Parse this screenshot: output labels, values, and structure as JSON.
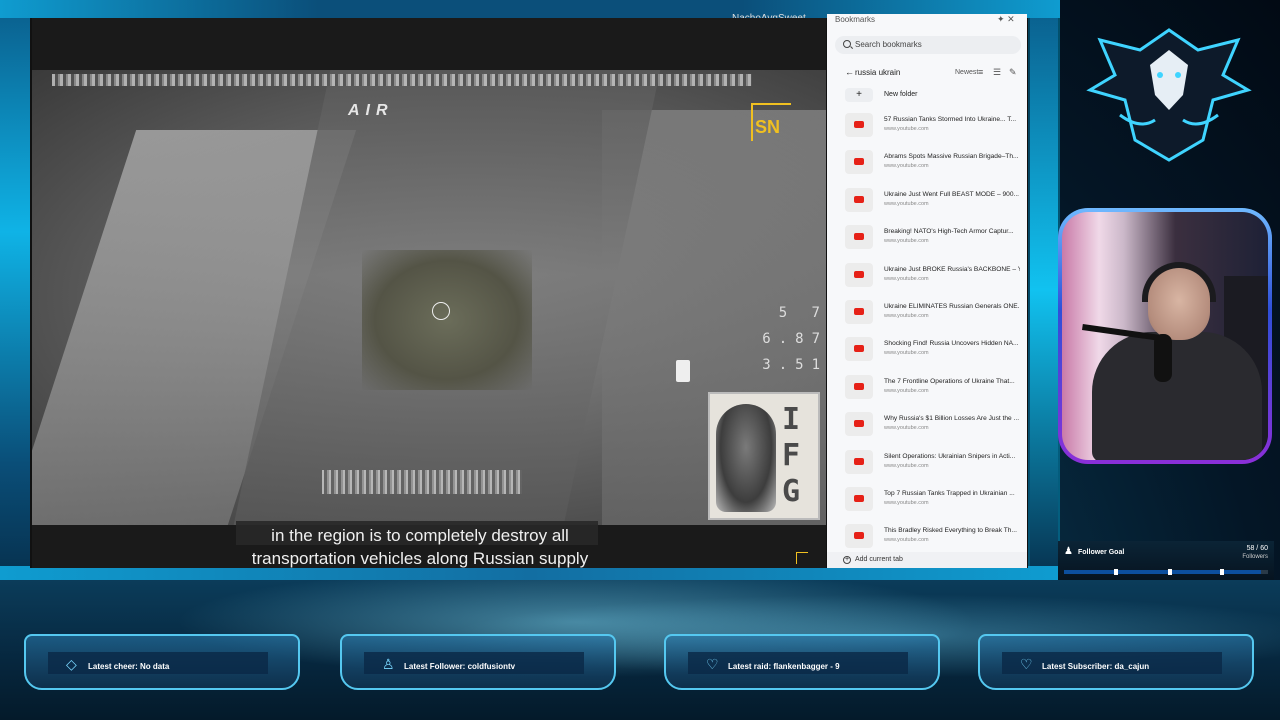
{
  "stream": {
    "channel_name": "NachoAvgSweet"
  },
  "video": {
    "osd_air": "AIR",
    "osd_lines": [
      "5  7",
      "6.87",
      "3.51"
    ],
    "watermark_top": "SN",
    "watermark_bottom": [
      "I",
      "F",
      "G"
    ],
    "subtitle_lines": [
      "in the region is to completely destroy all",
      "transportation vehicles along Russian supply"
    ]
  },
  "bookmarks": {
    "title": "Bookmarks",
    "search_placeholder": "Search bookmarks",
    "folder_name": "russia ukrain",
    "sort_label": "Newest",
    "new_folder_label": "New folder",
    "add_current_tab_label": "Add current tab",
    "items": [
      {
        "title": "57 Russian Tanks Stormed Into Ukraine... T...",
        "url": "www.youtube.com"
      },
      {
        "title": "Abrams Spots Massive Russian Brigade–Th...",
        "url": "www.youtube.com"
      },
      {
        "title": "Ukraine Just Went Full BEAST MODE – 900...",
        "url": "www.youtube.com"
      },
      {
        "title": "Breaking! NATO's High-Tech Armor Captur...",
        "url": "www.youtube.com"
      },
      {
        "title": "Ukraine Just BROKE Russia's BACKBONE – Y...",
        "url": "www.youtube.com"
      },
      {
        "title": "Ukraine ELIMINATES Russian Generals ONE...",
        "url": "www.youtube.com"
      },
      {
        "title": "Shocking Find! Russia Uncovers Hidden NA...",
        "url": "www.youtube.com"
      },
      {
        "title": "The 7 Frontline Operations of Ukraine That...",
        "url": "www.youtube.com"
      },
      {
        "title": "Why Russia's $1 Billion Losses Are Just the ...",
        "url": "www.youtube.com"
      },
      {
        "title": "Silent Operations: Ukrainian Snipers in Acti...",
        "url": "www.youtube.com"
      },
      {
        "title": "Top 7 Russian Tanks Trapped in Ukrainian ...",
        "url": "www.youtube.com"
      },
      {
        "title": "This Bradley Risked Everything to Break Th...",
        "url": "www.youtube.com"
      }
    ]
  },
  "follower_goal": {
    "label": "Follower Goal",
    "count": "58 / 60",
    "unit": "Followers",
    "progress_fraction": 0.967
  },
  "alerts": [
    {
      "text": "Latest cheer: No data",
      "icon": "diamond-icon"
    },
    {
      "text": "Latest Follower: coldfusiontv",
      "icon": "person-icon"
    },
    {
      "text": "Latest raid: flankenbagger - 9",
      "icon": "heart-icon"
    },
    {
      "text": "Latest Subscriber: da_cajun",
      "icon": "heart-icon"
    }
  ],
  "colors": {
    "accent": "#55c8f0",
    "youtube_red": "#e62117",
    "watermark_yellow": "#f0c020"
  }
}
